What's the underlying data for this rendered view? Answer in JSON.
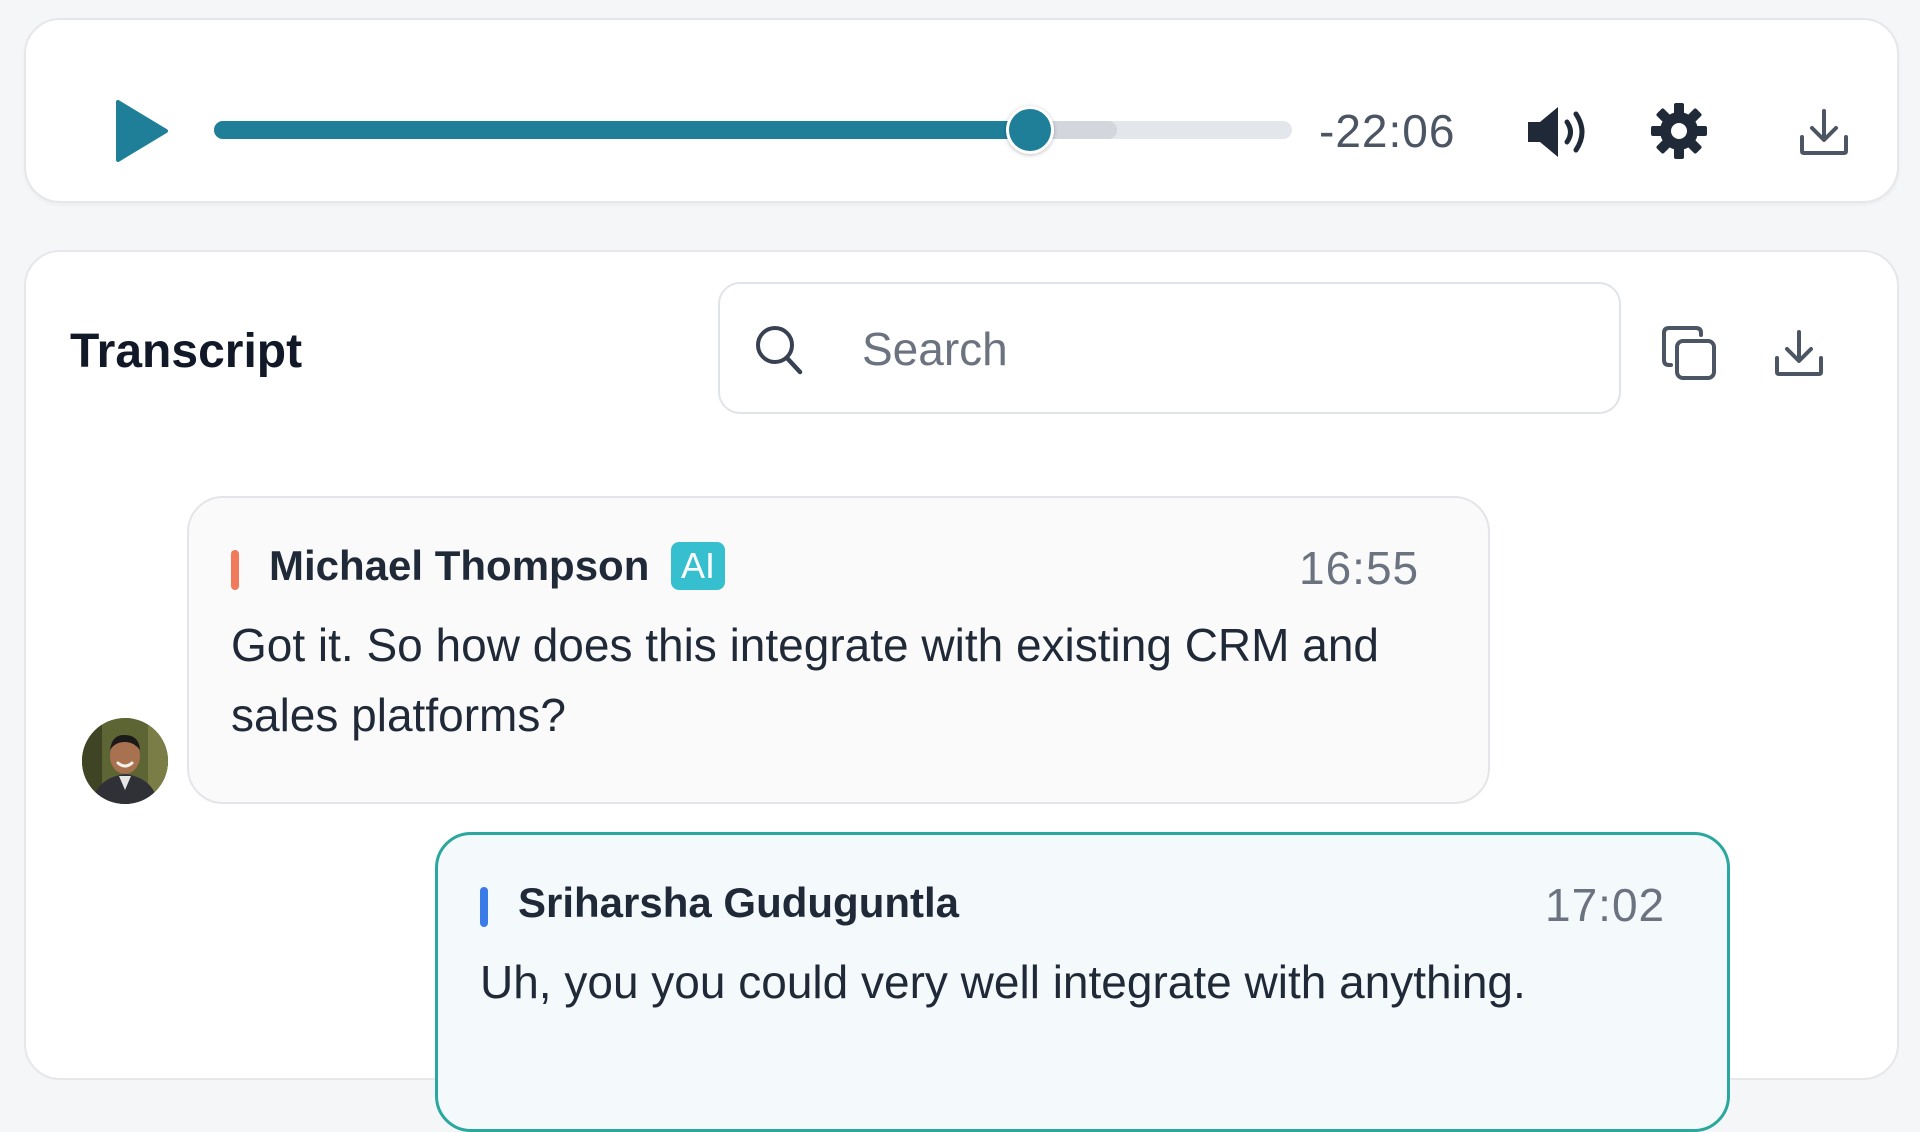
{
  "player": {
    "play_icon": "play-icon",
    "progress": 0.757,
    "buffered": 0.838,
    "time_remaining": "-22:06",
    "volume_icon": "volume-icon",
    "settings_icon": "gear-icon",
    "download_icon": "download-icon",
    "accent_color": "#1f7f99"
  },
  "transcript": {
    "title": "Transcript",
    "search_placeholder": "Search",
    "copy_icon": "copy-icon",
    "download_icon": "download-icon"
  },
  "messages": [
    {
      "speaker": "Michael Thompson",
      "badge": "AI",
      "time": "16:55",
      "text": "Got it. So how does this integrate with existing CRM and sales platforms?",
      "speaker_color": "#f07a5a",
      "has_avatar": true
    },
    {
      "speaker": "Sriharsha Guduguntla",
      "time": "17:02",
      "text": "Uh, you you could very well integrate with anything.",
      "speaker_color": "#3b7be8",
      "active": true
    }
  ]
}
